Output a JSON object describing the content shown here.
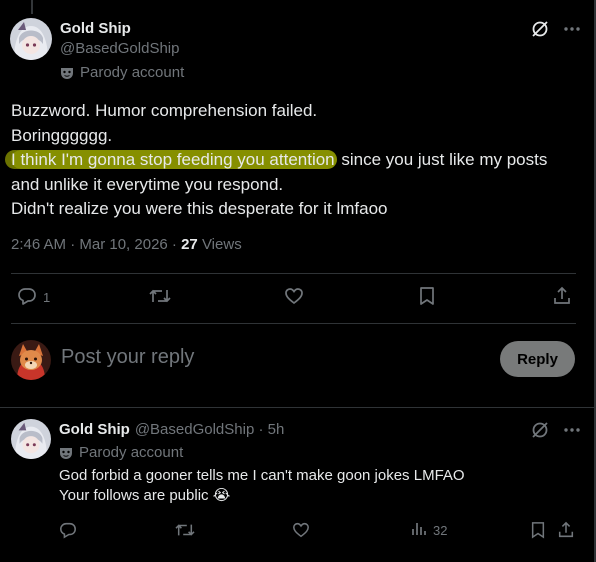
{
  "main_tweet": {
    "display_name": "Gold Ship",
    "handle": "@BasedGoldShip",
    "badge_label": "Parody account",
    "lines": [
      "Buzzword. Humor comprehension failed.",
      "Boringggggg.",
      "I think I'm gonna stop feeding you attention",
      " since you just like my posts",
      "and unlike it everytime you respond.",
      "Didn't realize you were this desperate for it lmfaoo"
    ],
    "timestamp": "2:46 AM · Mar 10, 2026 · ",
    "views_count": "27",
    "views_label": " Views",
    "actions": {
      "reply_count": "1"
    }
  },
  "composer": {
    "placeholder": "Post your reply",
    "button_label": "Reply"
  },
  "reply_tweet": {
    "display_name": "Gold Ship",
    "handle_time": "@BasedGoldShip · 5h",
    "badge_label": "Parody account",
    "lines": [
      "God forbid a gooner tells me I can't make goon jokes LMFAO",
      "Your follows are public 😭"
    ],
    "views": "32"
  },
  "colors": {
    "background": "#000000",
    "text": "#e7e9ea",
    "muted": "#71767b",
    "highlight": "#98a300",
    "reply_button": "#787a7a"
  },
  "icons": [
    "grok-icon",
    "more-icon",
    "mask-icon",
    "reply-icon",
    "repost-icon",
    "like-icon",
    "bookmark-icon",
    "share-icon",
    "views-icon"
  ]
}
